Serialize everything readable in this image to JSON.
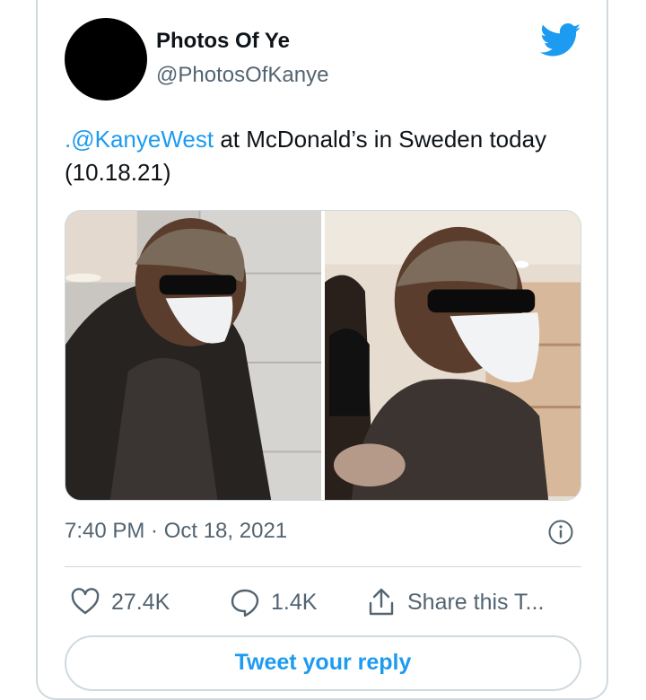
{
  "author": {
    "display_name": "Photos Of Ye",
    "handle": "@PhotosOfKanye"
  },
  "tweet": {
    "mention": ".@KanyeWest",
    "text_rest": " at McDonald’s in Sweden today (10.18.21)",
    "timestamp": "7:40 PM · Oct 18, 2021"
  },
  "media": [
    {
      "icon": "photo-left"
    },
    {
      "icon": "photo-right"
    }
  ],
  "actions": {
    "like_count": "27.4K",
    "reply_count": "1.4K",
    "share_label": "Share this T..."
  },
  "reply": {
    "label": "Tweet your reply"
  },
  "colors": {
    "accent": "#1d9bf0",
    "secondary_text": "#536471",
    "border": "#cfd9de"
  }
}
